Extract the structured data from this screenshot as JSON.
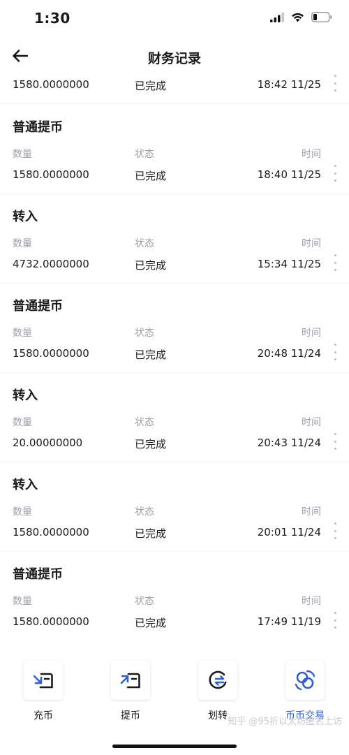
{
  "status_bar": {
    "time": "1:30"
  },
  "nav": {
    "title": "财务记录"
  },
  "partial_record": {
    "amount": "1580.0000000",
    "status": "已完成",
    "time": "18:42 11/25"
  },
  "records": [
    {
      "type": "普通提币",
      "amount_label": "数量",
      "status_label": "状态",
      "time_label": "时间",
      "amount": "1580.0000000",
      "status": "已完成",
      "time": "18:40 11/25"
    },
    {
      "type": "转入",
      "amount_label": "数量",
      "status_label": "状态",
      "time_label": "时间",
      "amount": "4732.0000000",
      "status": "已完成",
      "time": "15:34 11/25"
    },
    {
      "type": "普通提币",
      "amount_label": "数量",
      "status_label": "状态",
      "time_label": "时间",
      "amount": "1580.0000000",
      "status": "已完成",
      "time": "20:48 11/24"
    },
    {
      "type": "转入",
      "amount_label": "数量",
      "status_label": "状态",
      "time_label": "时间",
      "amount": "20.00000000",
      "status": "已完成",
      "time": "20:43 11/24"
    },
    {
      "type": "转入",
      "amount_label": "数量",
      "status_label": "状态",
      "time_label": "时间",
      "amount": "1580.0000000",
      "status": "已完成",
      "time": "20:01 11/24"
    },
    {
      "type": "普通提币",
      "amount_label": "数量",
      "status_label": "状态",
      "time_label": "时间",
      "amount": "1580.0000000",
      "status": "已完成",
      "time": "17:49 11/19"
    }
  ],
  "tab_bar": {
    "tabs": [
      {
        "label": "充币",
        "icon": "deposit-icon"
      },
      {
        "label": "提币",
        "icon": "withdraw-icon"
      },
      {
        "label": "划转",
        "icon": "transfer-icon"
      },
      {
        "label": "币币交易",
        "icon": "spot-trade-icon",
        "active": true
      }
    ]
  },
  "watermark": "知乎 @95折以太坊匿名上访",
  "colors": {
    "accent": "#2f5fd6",
    "label_gray": "#9aa0a8",
    "divider": "#f0f1f3"
  }
}
